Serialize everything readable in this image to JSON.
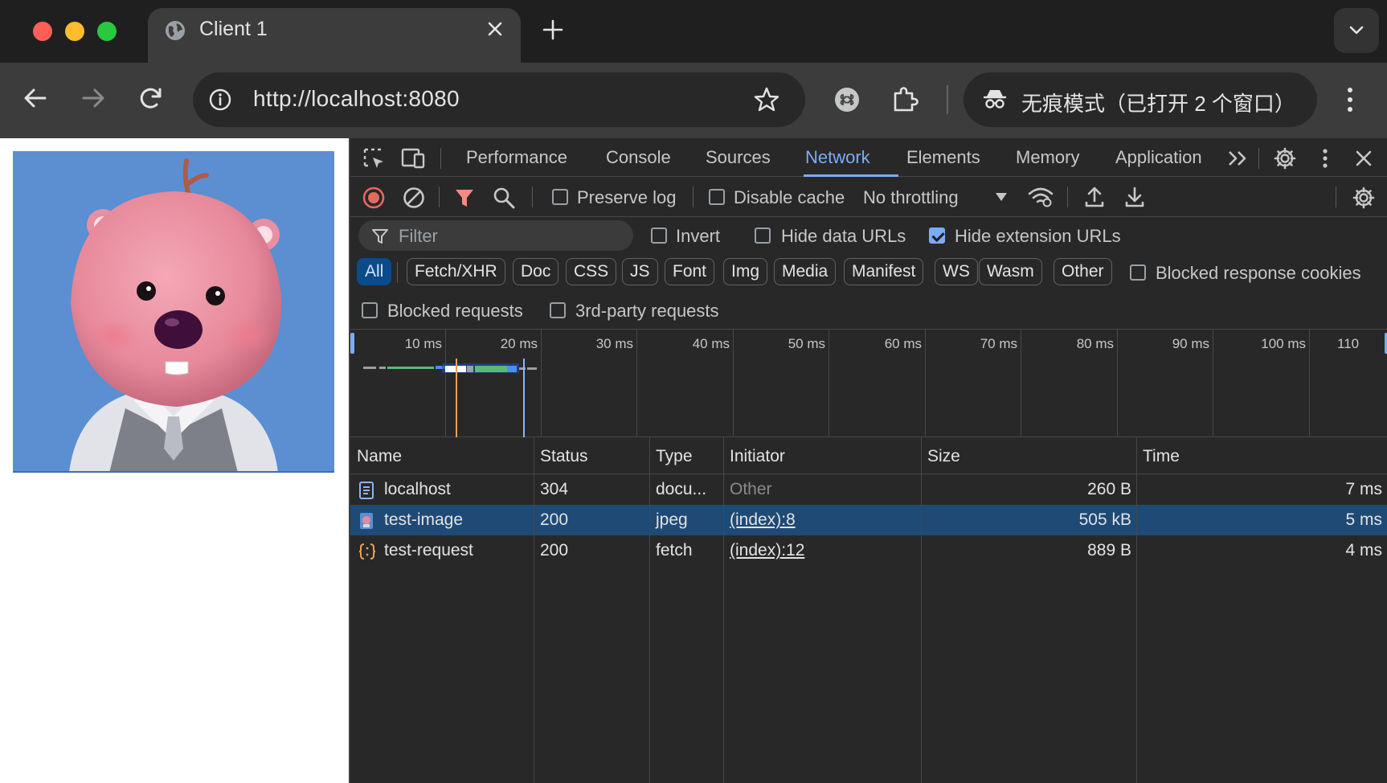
{
  "browser": {
    "tab_title": "Client 1",
    "url": "http://localhost:8080",
    "incognito_label": "无痕模式（已打开 2 个窗口）"
  },
  "devtools": {
    "tabs": [
      {
        "label": "Performance"
      },
      {
        "label": "Console"
      },
      {
        "label": "Sources"
      },
      {
        "label": "Network",
        "active": true
      },
      {
        "label": "Elements"
      },
      {
        "label": "Memory"
      },
      {
        "label": "Application"
      }
    ],
    "toolbar": {
      "preserve_log": "Preserve log",
      "disable_cache": "Disable cache",
      "throttling": "No throttling"
    },
    "filter": {
      "placeholder": "Filter",
      "invert": "Invert",
      "hide_data_urls": "Hide data URLs",
      "hide_extension_urls": "Hide extension URLs"
    },
    "type_filters": [
      "All",
      "Fetch/XHR",
      "Doc",
      "CSS",
      "JS",
      "Font",
      "Img",
      "Media",
      "Manifest",
      "WS",
      "Wasm",
      "Other"
    ],
    "blocked_response_cookies": "Blocked response cookies",
    "blocked_requests": "Blocked requests",
    "third_party_requests": "3rd-party requests",
    "timeline_ticks": [
      "10 ms",
      "20 ms",
      "30 ms",
      "40 ms",
      "50 ms",
      "60 ms",
      "70 ms",
      "80 ms",
      "90 ms",
      "100 ms",
      "110"
    ],
    "columns": {
      "name": "Name",
      "status": "Status",
      "type": "Type",
      "initiator": "Initiator",
      "size": "Size",
      "time": "Time"
    },
    "requests": [
      {
        "name": "localhost",
        "status": "304",
        "type": "docu...",
        "initiator": "Other",
        "size": "260 B",
        "time": "7 ms"
      },
      {
        "name": "test-image",
        "status": "200",
        "type": "jpeg",
        "initiator": "(index):8",
        "size": "505 kB",
        "time": "5 ms"
      },
      {
        "name": "test-request",
        "status": "200",
        "type": "fetch",
        "initiator": "(index):12",
        "size": "889 B",
        "time": "4 ms"
      }
    ]
  },
  "colors": {
    "accent": "#7cacf8",
    "selected_row": "#1e4a75",
    "record": "#e46962",
    "filter_active": "#f28b82"
  }
}
